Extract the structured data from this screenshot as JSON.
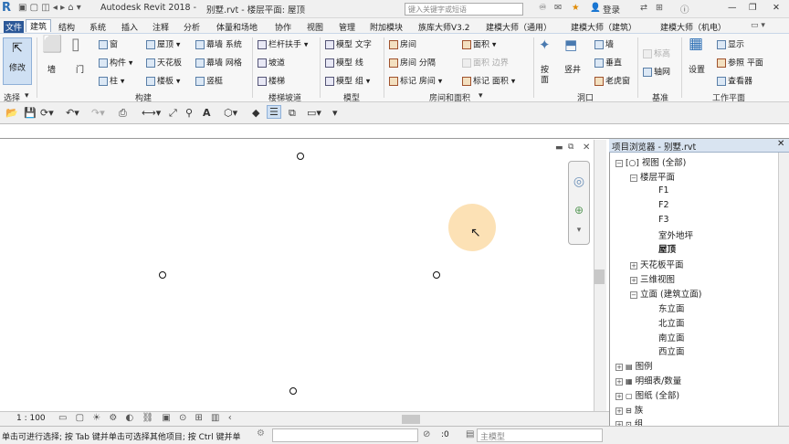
{
  "app_title": "Autodesk Revit 2018 -",
  "doc_title": "别墅.rvt - 楼层平面: 屋顶",
  "search_placeholder": "键入关键字或短语",
  "login": "登录",
  "menu": [
    "文件",
    "建筑",
    "结构",
    "系统",
    "插入",
    "注释",
    "分析",
    "体量和场地",
    "协作",
    "视图",
    "管理",
    "附加模块",
    "族库大师V3.2",
    "建模大师（通用）",
    "建模大师（建筑）",
    "建模大师（机电）"
  ],
  "ribbon": {
    "modify": "修改",
    "select": "选择",
    "wall": "墙",
    "door": "门",
    "window": "窗",
    "component": "构件",
    "column": "柱",
    "roof": "屋顶",
    "ceiling": "天花板",
    "floor": "楼板",
    "curtain_system": "幕墙 系统",
    "curtain_grid": "幕墙 网格",
    "mullion": "竖梃",
    "group_build": "构建",
    "railing": "栏杆扶手",
    "ramp": "坡道",
    "stair": "楼梯",
    "group_circ": "楼梯坡道",
    "model_text": "模型 文字",
    "model_line": "模型 线",
    "model_group": "模型 组",
    "group_model": "模型",
    "room": "房间",
    "room_sep": "房间 分隔",
    "tag_room": "标记 房间",
    "area": "面积",
    "area_boundary": "面积 边界",
    "tag_area": "标记 面积",
    "group_room": "房间和面积",
    "by_face": "按面",
    "shaft": "竖井",
    "wall_open": "墙",
    "vertical": "垂直",
    "dormer": "老虎窗",
    "group_opening": "洞口",
    "level": "标高",
    "grid": "轴网",
    "group_datum": "基准",
    "set": "设置",
    "show": "显示",
    "ref_plane": "参照 平面",
    "viewer": "查看器",
    "group_work": "工作平面"
  },
  "browser": {
    "title": "项目浏览器 - 别墅.rvt",
    "views": "视图 (全部)",
    "floor_plans": "楼层平面",
    "f1": "F1",
    "f2": "F2",
    "f3": "F3",
    "outdoor": "室外地坪",
    "roof": "屋顶",
    "ceiling_plans": "天花板平面",
    "views_3d": "三维视图",
    "elevations": "立面 (建筑立面)",
    "east": "东立面",
    "north": "北立面",
    "south": "南立面",
    "west": "西立面",
    "legends": "图例",
    "schedules": "明细表/数量",
    "sheets": "图纸 (全部)",
    "families": "族",
    "groups": "组"
  },
  "scale": "1 : 100",
  "status_text": "单击可进行选择; 按 Tab 键并单击可选择其他项目; 按 Ctrl 键并单",
  "status_count": ":0",
  "model_select": "主模型"
}
